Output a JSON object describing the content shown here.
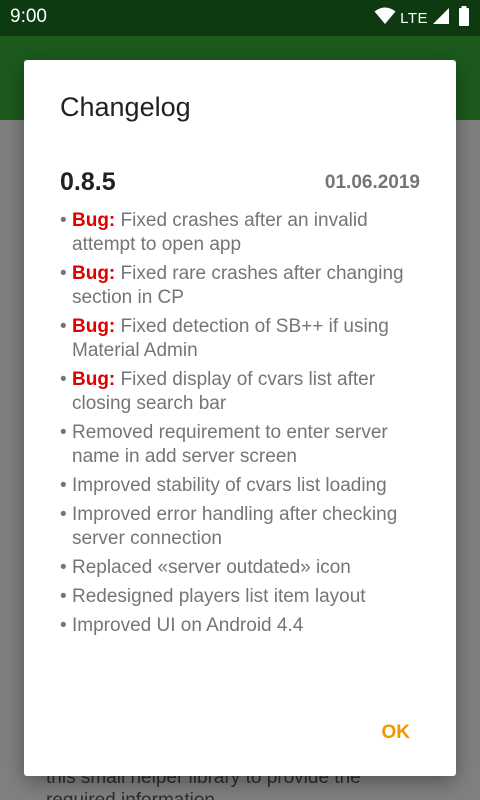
{
  "status_bar": {
    "time": "9:00",
    "network": "LTE",
    "icons": [
      "wifi-icon",
      "cell-signal-icon",
      "battery-icon"
    ]
  },
  "background": {
    "line1": "this small helper library to provide the",
    "line2": "required information"
  },
  "dialog": {
    "title": "Changelog",
    "version": "0.8.5",
    "date": "01.06.2019",
    "bullet": "•",
    "items": [
      {
        "tag": "Bug:",
        "text": " Fixed crashes after an invalid attempt to open app"
      },
      {
        "tag": "Bug:",
        "text": " Fixed rare crashes after changing section in CP"
      },
      {
        "tag": "Bug:",
        "text": " Fixed detection of SB++ if using Material Admin"
      },
      {
        "tag": "Bug:",
        "text": " Fixed display of cvars list after closing search bar"
      },
      {
        "tag": "",
        "text": "Removed requirement to enter server name in add server screen"
      },
      {
        "tag": "",
        "text": "Improved stability of cvars list loading"
      },
      {
        "tag": "",
        "text": "Improved error handling after checking server connection"
      },
      {
        "tag": "",
        "text": "Replaced «server outdated» icon"
      },
      {
        "tag": "",
        "text": "Redesigned players list item layout"
      },
      {
        "tag": "",
        "text": "Improved UI on Android 4.4"
      }
    ],
    "ok_label": "OK"
  },
  "colors": {
    "status_bar": "#0d3a10",
    "app_bar": "#1c5a1e",
    "bug_tag": "#e00000",
    "accent": "#f29600"
  }
}
